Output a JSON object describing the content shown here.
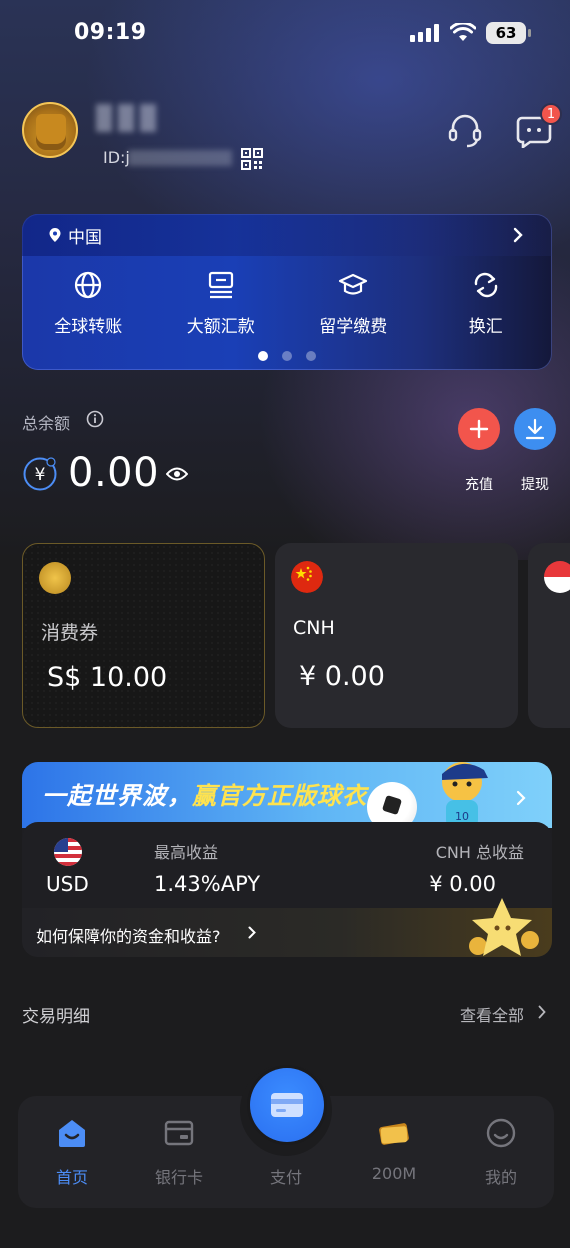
{
  "status_bar": {
    "time": "09:19",
    "battery": "63"
  },
  "header": {
    "id_label": "ID:j",
    "notification_count": "1"
  },
  "services": {
    "location": "中国",
    "items": [
      {
        "label": "全球转账",
        "icon": "globe-icon"
      },
      {
        "label": "大额汇款",
        "icon": "large-remittance-icon"
      },
      {
        "label": "留学缴费",
        "icon": "graduation-cap-icon"
      },
      {
        "label": "换汇",
        "icon": "exchange-icon"
      }
    ],
    "carousel_pages": 3,
    "active_page": 1
  },
  "balance": {
    "label": "总余额",
    "value": "0.00",
    "currency_symbol": "¥",
    "recharge_label": "充值",
    "withdraw_label": "提现"
  },
  "wallets": [
    {
      "name": "消费券",
      "amount": "S$ 10.00"
    },
    {
      "name": "CNH",
      "amount": "¥ 0.00"
    }
  ],
  "promo": {
    "title_prefix": "一起世界波，",
    "title_highlight": "赢官方正版球衣",
    "currency": "USD",
    "apy_label": "最高收益",
    "apy_value": "1.43%APY",
    "cnh_label": "CNH 总收益",
    "cnh_value": "¥ 0.00",
    "guarantee_text": "如何保障你的资金和收益?"
  },
  "transactions": {
    "title": "交易明细",
    "view_all": "查看全部"
  },
  "nav": {
    "items": [
      {
        "label": "首页",
        "icon": "home-icon",
        "active": true
      },
      {
        "label": "银行卡",
        "icon": "bank-card-icon",
        "active": false
      },
      {
        "label": "支付",
        "icon": "pay-icon",
        "active": false
      },
      {
        "label": "200M",
        "icon": "gold-ticket-icon",
        "active": false
      },
      {
        "label": "我的",
        "icon": "profile-icon",
        "active": false
      }
    ]
  },
  "colors": {
    "accent_blue": "#4c8df5",
    "recharge_red": "#f2554c",
    "withdraw_blue": "#3d8ef0",
    "promo_yellow": "#ffe34f"
  }
}
